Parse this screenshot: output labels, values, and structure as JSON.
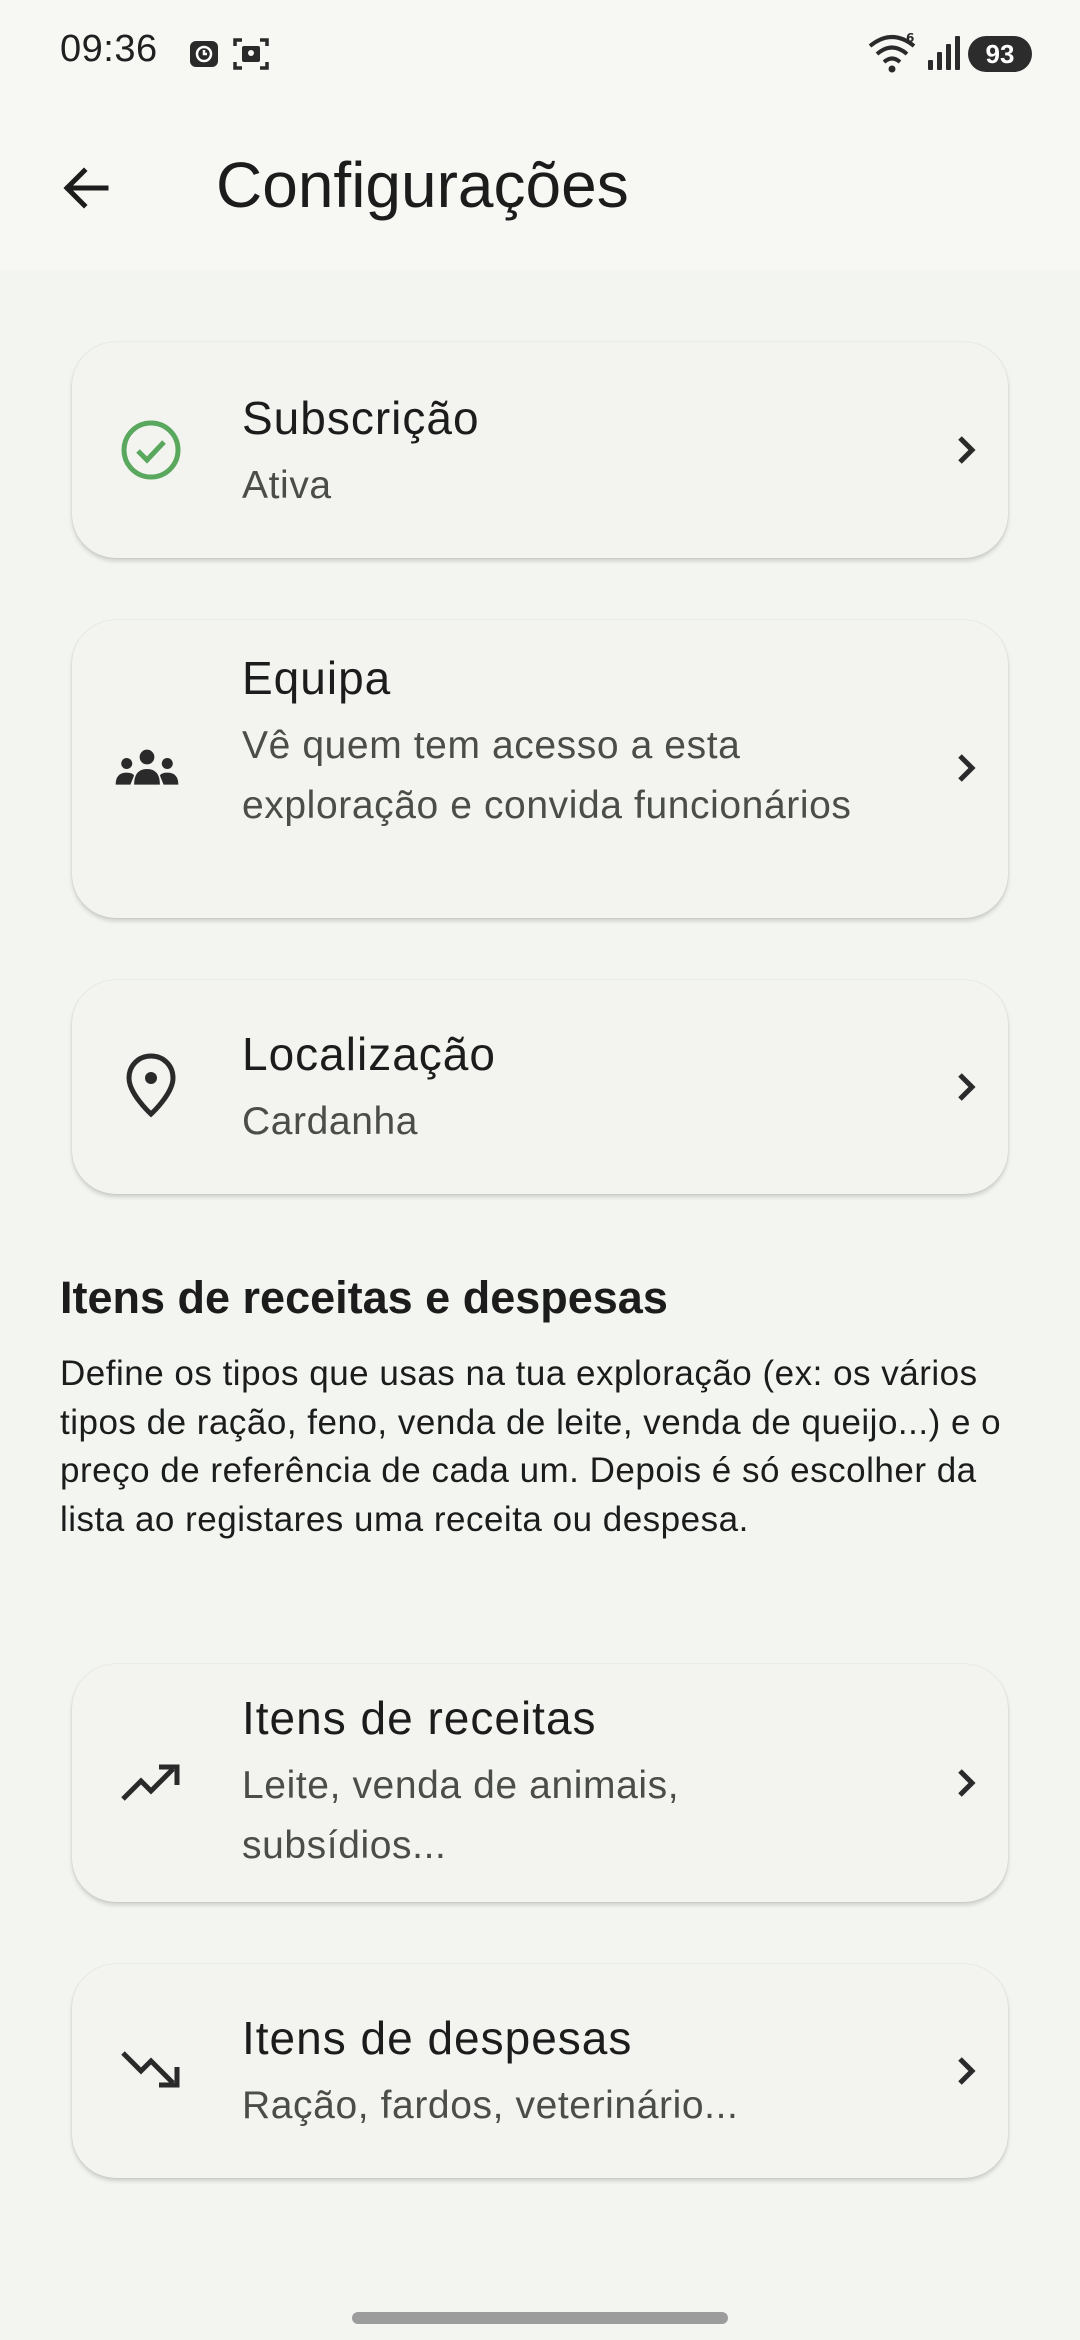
{
  "status_bar": {
    "time": "09:36",
    "battery": "93",
    "icons": [
      "alarm-icon",
      "screenshot-icon",
      "wifi-6-icon",
      "signal-icon"
    ]
  },
  "app_bar": {
    "title": "Configurações",
    "back_icon": "arrow-back-icon"
  },
  "settings": [
    {
      "id": "subscription",
      "title": "Subscrição",
      "subtitle": "Ativa",
      "icon": "check-circle-icon",
      "icon_color": "#5aa75e"
    },
    {
      "id": "team",
      "title": "Equipa",
      "subtitle": "Vê quem tem acesso a esta exploração e convida funcionários",
      "icon": "group-icon"
    },
    {
      "id": "location",
      "title": "Localização",
      "subtitle": "Cardanha",
      "icon": "location-pin-icon"
    }
  ],
  "items_section": {
    "title": "Itens de receitas e despesas",
    "description": "Define os tipos que usas na tua exploração (ex: os vários tipos de ração, feno, venda de leite, venda de queijo...) e o preço de referência de cada um. Depois é só escolher da lista ao registares uma receita ou despesa.",
    "items": [
      {
        "id": "income-items",
        "title": "Itens de receitas",
        "subtitle": "Leite, venda de animais, subsídios...",
        "icon": "trending-up-icon"
      },
      {
        "id": "expense-items",
        "title": "Itens de despesas",
        "subtitle": "Ração, fardos, veterinário...",
        "icon": "trending-down-icon"
      }
    ]
  },
  "colors": {
    "background": "#f3f5f0",
    "card": "#f3f4ef",
    "accent_green": "#5aa75e",
    "text_primary": "#1c1c1c",
    "text_secondary": "#4a4d48"
  }
}
